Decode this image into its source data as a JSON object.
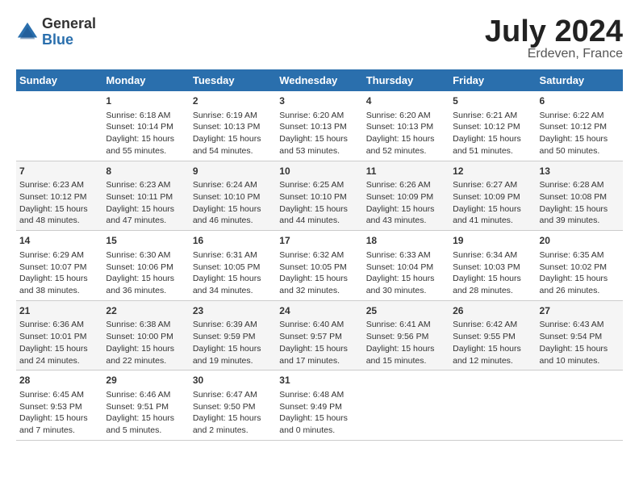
{
  "logo": {
    "general": "General",
    "blue": "Blue"
  },
  "title": {
    "month_year": "July 2024",
    "location": "Erdeven, France"
  },
  "headers": [
    "Sunday",
    "Monday",
    "Tuesday",
    "Wednesday",
    "Thursday",
    "Friday",
    "Saturday"
  ],
  "weeks": [
    [
      {
        "day": "",
        "info": ""
      },
      {
        "day": "1",
        "info": "Sunrise: 6:18 AM\nSunset: 10:14 PM\nDaylight: 15 hours\nand 55 minutes."
      },
      {
        "day": "2",
        "info": "Sunrise: 6:19 AM\nSunset: 10:13 PM\nDaylight: 15 hours\nand 54 minutes."
      },
      {
        "day": "3",
        "info": "Sunrise: 6:20 AM\nSunset: 10:13 PM\nDaylight: 15 hours\nand 53 minutes."
      },
      {
        "day": "4",
        "info": "Sunrise: 6:20 AM\nSunset: 10:13 PM\nDaylight: 15 hours\nand 52 minutes."
      },
      {
        "day": "5",
        "info": "Sunrise: 6:21 AM\nSunset: 10:12 PM\nDaylight: 15 hours\nand 51 minutes."
      },
      {
        "day": "6",
        "info": "Sunrise: 6:22 AM\nSunset: 10:12 PM\nDaylight: 15 hours\nand 50 minutes."
      }
    ],
    [
      {
        "day": "7",
        "info": "Sunrise: 6:23 AM\nSunset: 10:12 PM\nDaylight: 15 hours\nand 48 minutes."
      },
      {
        "day": "8",
        "info": "Sunrise: 6:23 AM\nSunset: 10:11 PM\nDaylight: 15 hours\nand 47 minutes."
      },
      {
        "day": "9",
        "info": "Sunrise: 6:24 AM\nSunset: 10:10 PM\nDaylight: 15 hours\nand 46 minutes."
      },
      {
        "day": "10",
        "info": "Sunrise: 6:25 AM\nSunset: 10:10 PM\nDaylight: 15 hours\nand 44 minutes."
      },
      {
        "day": "11",
        "info": "Sunrise: 6:26 AM\nSunset: 10:09 PM\nDaylight: 15 hours\nand 43 minutes."
      },
      {
        "day": "12",
        "info": "Sunrise: 6:27 AM\nSunset: 10:09 PM\nDaylight: 15 hours\nand 41 minutes."
      },
      {
        "day": "13",
        "info": "Sunrise: 6:28 AM\nSunset: 10:08 PM\nDaylight: 15 hours\nand 39 minutes."
      }
    ],
    [
      {
        "day": "14",
        "info": "Sunrise: 6:29 AM\nSunset: 10:07 PM\nDaylight: 15 hours\nand 38 minutes."
      },
      {
        "day": "15",
        "info": "Sunrise: 6:30 AM\nSunset: 10:06 PM\nDaylight: 15 hours\nand 36 minutes."
      },
      {
        "day": "16",
        "info": "Sunrise: 6:31 AM\nSunset: 10:05 PM\nDaylight: 15 hours\nand 34 minutes."
      },
      {
        "day": "17",
        "info": "Sunrise: 6:32 AM\nSunset: 10:05 PM\nDaylight: 15 hours\nand 32 minutes."
      },
      {
        "day": "18",
        "info": "Sunrise: 6:33 AM\nSunset: 10:04 PM\nDaylight: 15 hours\nand 30 minutes."
      },
      {
        "day": "19",
        "info": "Sunrise: 6:34 AM\nSunset: 10:03 PM\nDaylight: 15 hours\nand 28 minutes."
      },
      {
        "day": "20",
        "info": "Sunrise: 6:35 AM\nSunset: 10:02 PM\nDaylight: 15 hours\nand 26 minutes."
      }
    ],
    [
      {
        "day": "21",
        "info": "Sunrise: 6:36 AM\nSunset: 10:01 PM\nDaylight: 15 hours\nand 24 minutes."
      },
      {
        "day": "22",
        "info": "Sunrise: 6:38 AM\nSunset: 10:00 PM\nDaylight: 15 hours\nand 22 minutes."
      },
      {
        "day": "23",
        "info": "Sunrise: 6:39 AM\nSunset: 9:59 PM\nDaylight: 15 hours\nand 19 minutes."
      },
      {
        "day": "24",
        "info": "Sunrise: 6:40 AM\nSunset: 9:57 PM\nDaylight: 15 hours\nand 17 minutes."
      },
      {
        "day": "25",
        "info": "Sunrise: 6:41 AM\nSunset: 9:56 PM\nDaylight: 15 hours\nand 15 minutes."
      },
      {
        "day": "26",
        "info": "Sunrise: 6:42 AM\nSunset: 9:55 PM\nDaylight: 15 hours\nand 12 minutes."
      },
      {
        "day": "27",
        "info": "Sunrise: 6:43 AM\nSunset: 9:54 PM\nDaylight: 15 hours\nand 10 minutes."
      }
    ],
    [
      {
        "day": "28",
        "info": "Sunrise: 6:45 AM\nSunset: 9:53 PM\nDaylight: 15 hours\nand 7 minutes."
      },
      {
        "day": "29",
        "info": "Sunrise: 6:46 AM\nSunset: 9:51 PM\nDaylight: 15 hours\nand 5 minutes."
      },
      {
        "day": "30",
        "info": "Sunrise: 6:47 AM\nSunset: 9:50 PM\nDaylight: 15 hours\nand 2 minutes."
      },
      {
        "day": "31",
        "info": "Sunrise: 6:48 AM\nSunset: 9:49 PM\nDaylight: 15 hours\nand 0 minutes."
      },
      {
        "day": "",
        "info": ""
      },
      {
        "day": "",
        "info": ""
      },
      {
        "day": "",
        "info": ""
      }
    ]
  ]
}
